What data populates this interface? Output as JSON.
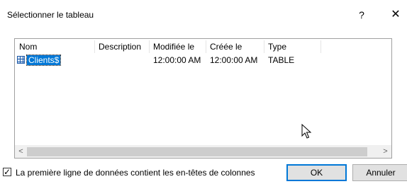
{
  "window": {
    "title": "Sélectionner le tableau",
    "help": "?",
    "close": "✕"
  },
  "table": {
    "columns": [
      "Nom",
      "Description",
      "Modifiée le",
      "Créée le",
      "Type"
    ],
    "rows": [
      {
        "name": "Clients$",
        "description": "",
        "modified": "12:00:00 AM",
        "created": "12:00:00 AM",
        "type": "TABLE",
        "selected": true
      }
    ]
  },
  "scrollbar": {
    "left_arrow": "<",
    "right_arrow": ">"
  },
  "options": {
    "header_checkbox_label": "La première ligne de données contient les en-têtes de colonnes",
    "header_checkbox_checked": true,
    "checkmark": "✓"
  },
  "buttons": {
    "ok": "OK",
    "cancel": "Annuler"
  }
}
